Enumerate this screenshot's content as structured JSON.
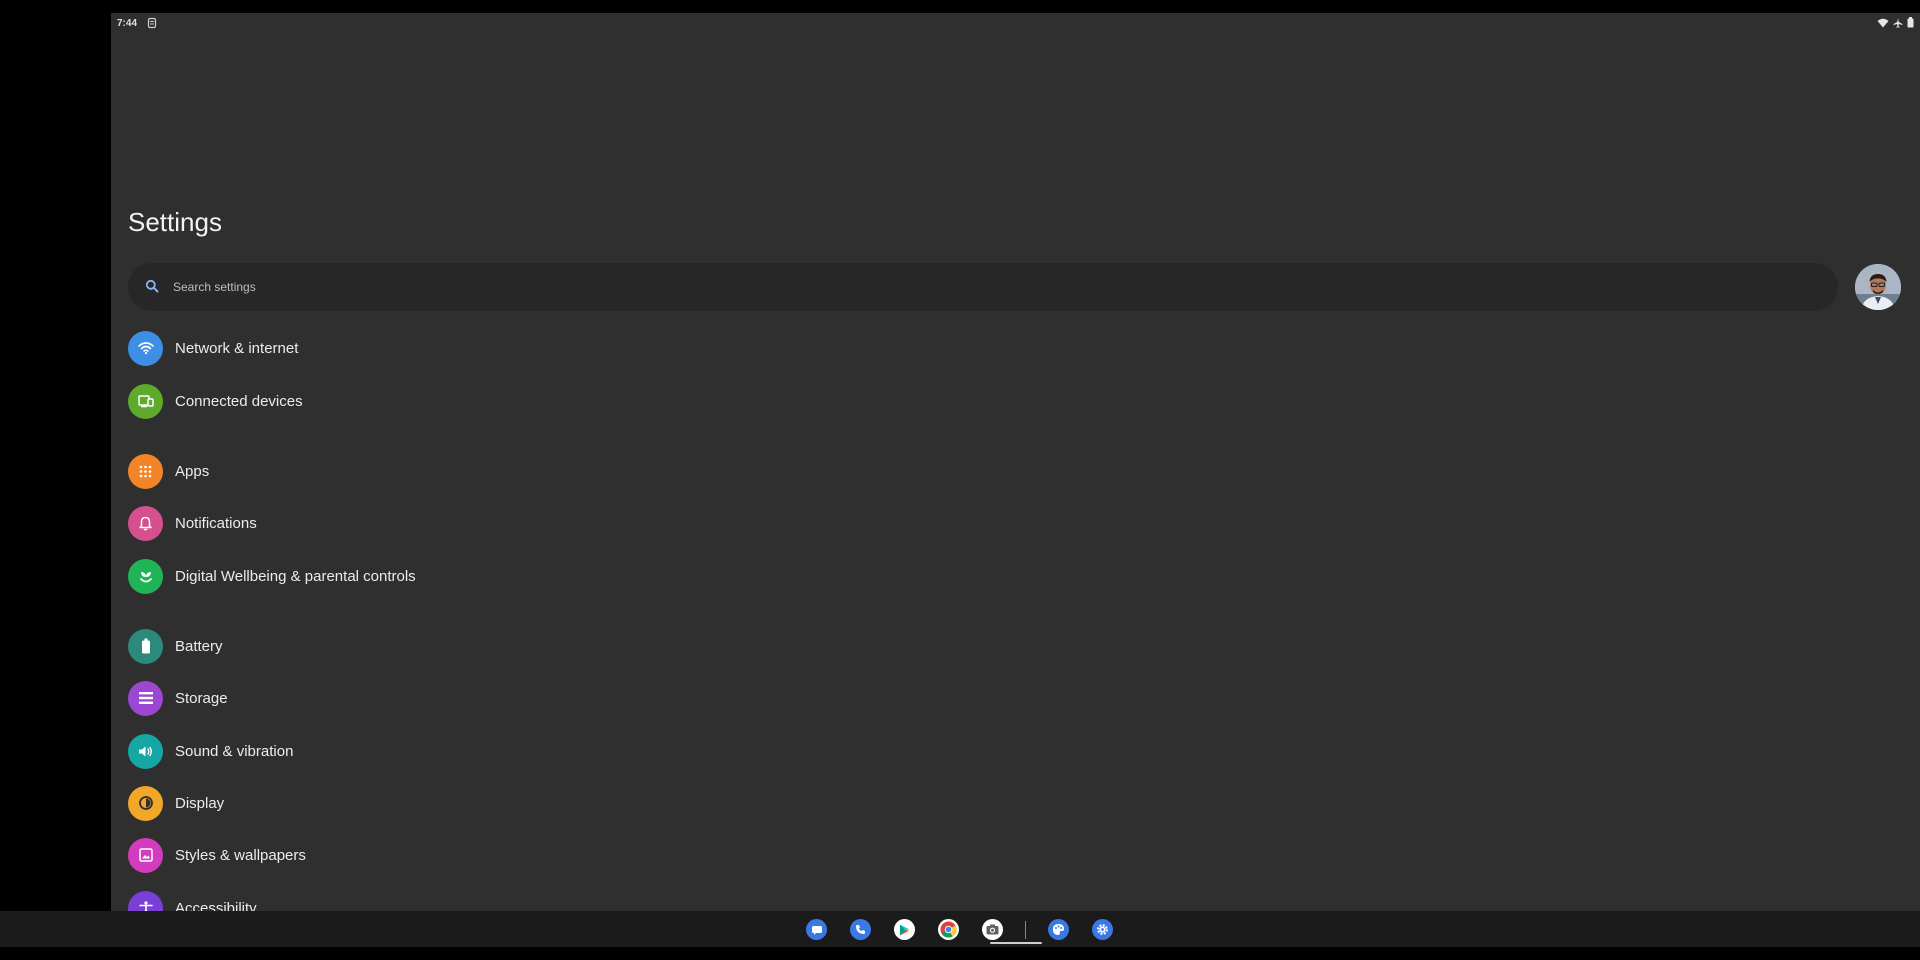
{
  "status_bar": {
    "time": "7:44",
    "icons": [
      "notification-icon",
      "wifi-icon",
      "airplane-icon",
      "battery-icon"
    ]
  },
  "page": {
    "title": "Settings"
  },
  "search": {
    "placeholder": "Search settings",
    "icon": "search-icon"
  },
  "menu": [
    {
      "label": "Network & internet",
      "icon": "wifi-icon",
      "color": "#3d8fe6"
    },
    {
      "label": "Connected devices",
      "icon": "devices-icon",
      "color": "#5eaa2a"
    },
    {
      "label": "Apps",
      "icon": "apps-grid-icon",
      "color": "#f28527"
    },
    {
      "label": "Notifications",
      "icon": "bell-icon",
      "color": "#d6508f"
    },
    {
      "label": "Digital Wellbeing & parental controls",
      "icon": "wellbeing-icon",
      "color": "#1fb556"
    },
    {
      "label": "Battery",
      "icon": "battery-icon",
      "color": "#2b8a7c"
    },
    {
      "label": "Storage",
      "icon": "storage-icon",
      "color": "#9b47d1"
    },
    {
      "label": "Sound & vibration",
      "icon": "volume-icon",
      "color": "#16a6a3"
    },
    {
      "label": "Display",
      "icon": "brightness-icon",
      "color": "#f2a729"
    },
    {
      "label": "Styles & wallpapers",
      "icon": "palette-icon",
      "color": "#d43cbf"
    },
    {
      "label": "Accessibility",
      "icon": "accessibility-icon",
      "color": "#7a3fd6"
    }
  ],
  "shelf": {
    "apps": [
      "messages-icon",
      "phone-icon",
      "play-store-icon",
      "chrome-icon",
      "camera-icon",
      "palette-icon",
      "settings-gear-icon"
    ]
  },
  "colors": {
    "screen_bg": "#2f2f2f",
    "search_bg": "#272727",
    "taskbar_bg": "#1b1b1b"
  }
}
